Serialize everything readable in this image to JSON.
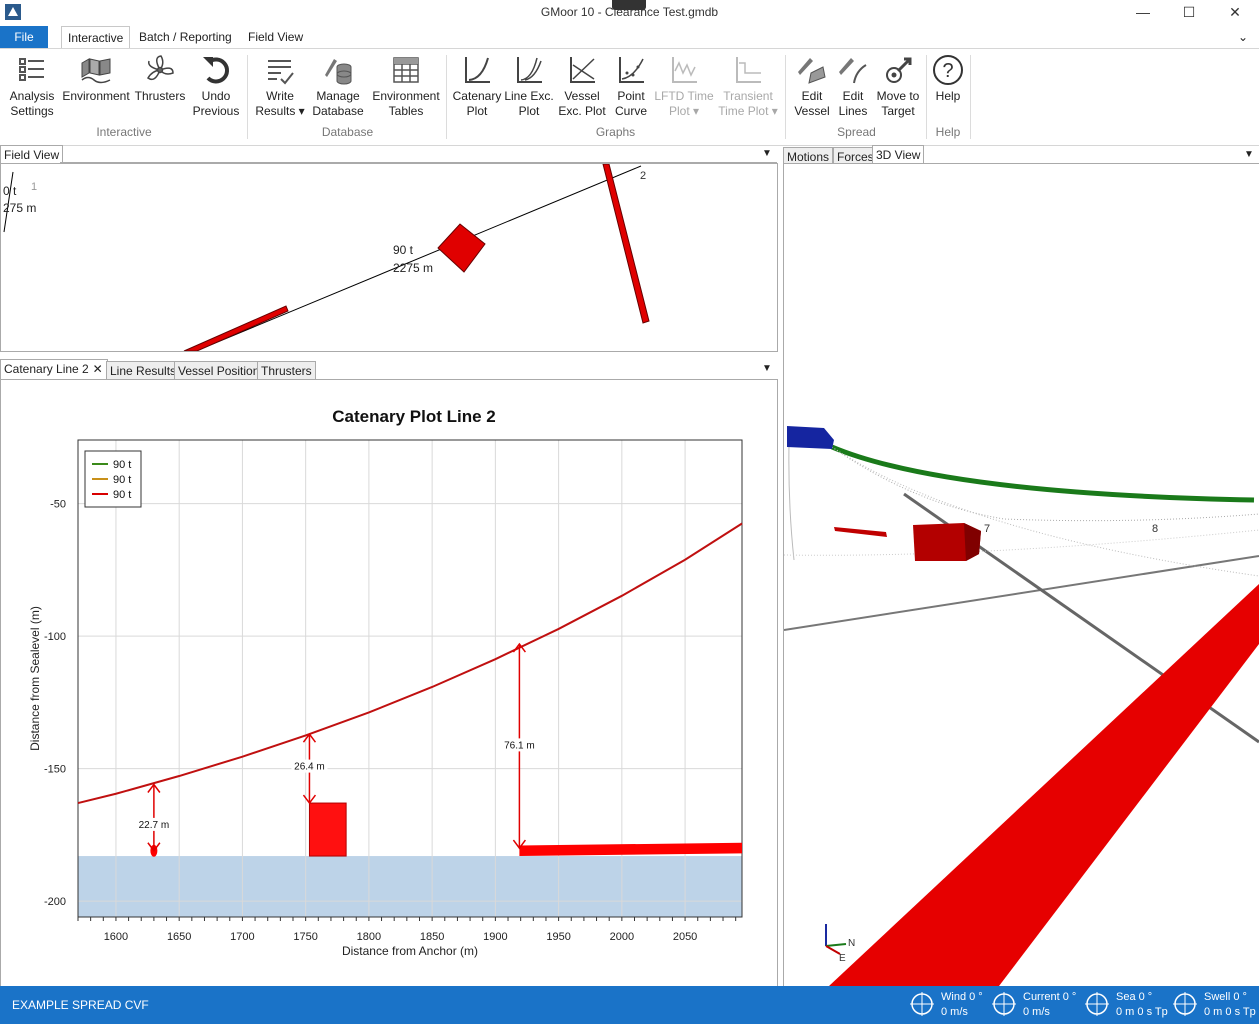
{
  "window": {
    "title": "GMoor 10 - Clearance Test.gmdb",
    "minimize": "—",
    "maximize": "☐",
    "close": "✕"
  },
  "menu": {
    "file": "File",
    "interactive": "Interactive",
    "batch": "Batch / Reporting",
    "fieldview": "Field View"
  },
  "ribbon": {
    "buttons": [
      {
        "line1": "Analysis",
        "line2": "Settings"
      },
      {
        "line1": "Environment",
        "line2": ""
      },
      {
        "line1": "Thrusters",
        "line2": ""
      },
      {
        "line1": "Undo",
        "line2": "Previous"
      },
      {
        "line1": "Write",
        "line2": "Results ▾"
      },
      {
        "line1": "Manage",
        "line2": "Database"
      },
      {
        "line1": "Environment",
        "line2": "Tables"
      },
      {
        "line1": "Catenary",
        "line2": "Plot"
      },
      {
        "line1": "Line Exc.",
        "line2": "Plot"
      },
      {
        "line1": "Vessel",
        "line2": "Exc. Plot"
      },
      {
        "line1": "Point",
        "line2": "Curve"
      },
      {
        "line1": "LFTD Time",
        "line2": "Plot ▾"
      },
      {
        "line1": "Transient",
        "line2": "Time Plot ▾"
      },
      {
        "line1": "Edit",
        "line2": "Vessel"
      },
      {
        "line1": "Edit",
        "line2": "Lines"
      },
      {
        "line1": "Move to",
        "line2": "Target"
      },
      {
        "line1": "Help",
        "line2": ""
      }
    ],
    "groups": [
      "Interactive",
      "Database",
      "Graphs",
      "Spread",
      "Help"
    ]
  },
  "fieldview": {
    "tab": "Field View",
    "labels": {
      "line1_num": "1",
      "line2_num": "2",
      "left_tension": "0 t",
      "left_length": "275 m",
      "tension": "90 t",
      "length": "2275 m"
    }
  },
  "plotpane": {
    "tabs": [
      "Catenary Line 2",
      "Line Results",
      "Vessel Position",
      "Thrusters"
    ],
    "close": "✕"
  },
  "rightpane": {
    "tabs": [
      "Motions",
      "Forces",
      "3D View"
    ],
    "labels": {
      "l7": "7",
      "l8": "8",
      "north": "N",
      "east": "E"
    }
  },
  "chart_data": {
    "type": "line",
    "title": "Catenary Plot Line 2",
    "xlabel": "Distance from Anchor (m)",
    "ylabel": "Distance from Sealevel (m)",
    "xlim": [
      1570,
      2095
    ],
    "ylim": [
      -206,
      -26
    ],
    "xticks": [
      1600,
      1650,
      1700,
      1750,
      1800,
      1850,
      1900,
      1950,
      2000,
      2050
    ],
    "yticks": [
      -50,
      -100,
      -150,
      -200
    ],
    "grid": true,
    "legend_position": "top-left",
    "legend": [
      {
        "label": "90 t",
        "color": "#3a8a1a"
      },
      {
        "label": "90 t",
        "color": "#c8901a"
      },
      {
        "label": "90 t",
        "color": "#d80000"
      }
    ],
    "series": [
      {
        "color": "#c01010",
        "x": [
          1570,
          1600,
          1650,
          1700,
          1750,
          1800,
          1850,
          1900,
          1950,
          2000,
          2050,
          2095
        ],
        "y": [
          -163,
          -159.5,
          -152.8,
          -145.5,
          -137.5,
          -128.8,
          -119.2,
          -108.7,
          -97.3,
          -84.8,
          -71.2,
          -57.5
        ]
      }
    ],
    "seabed": {
      "depth": -183,
      "color": "#bdd3e8"
    },
    "obstacles": [
      {
        "shape": "ellipse",
        "x": 1630,
        "y": -181
      },
      {
        "shape": "box",
        "x0": 1753,
        "x1": 1782,
        "y0": -183,
        "y1": -163
      },
      {
        "shape": "slab",
        "x0": 1919,
        "x1": 2095,
        "y_left": -183,
        "y_right": -182,
        "thickness": 4
      }
    ],
    "clearances": [
      {
        "x": 1630,
        "from": -156,
        "to": -181,
        "label": "22.7 m",
        "label_y": -172
      },
      {
        "x": 1753,
        "from": -137,
        "to": -163,
        "label": "26.4 m",
        "label_y": -150
      },
      {
        "x": 1919,
        "from": -103,
        "to": -180,
        "label": "76.1 m",
        "label_y": -142
      },
      {
        "placeholder": true
      }
    ]
  },
  "status": {
    "spread": "EXAMPLE SPREAD CVF",
    "env": [
      {
        "title": "Wind 0 °",
        "value": "0 m/s"
      },
      {
        "title": "Current 0 °",
        "value": "0 m/s"
      },
      {
        "title": "Sea 0 °",
        "value": "0 m 0 s Tp"
      },
      {
        "title": "Swell 0 °",
        "value": "0 m 0 s Tp"
      }
    ]
  }
}
